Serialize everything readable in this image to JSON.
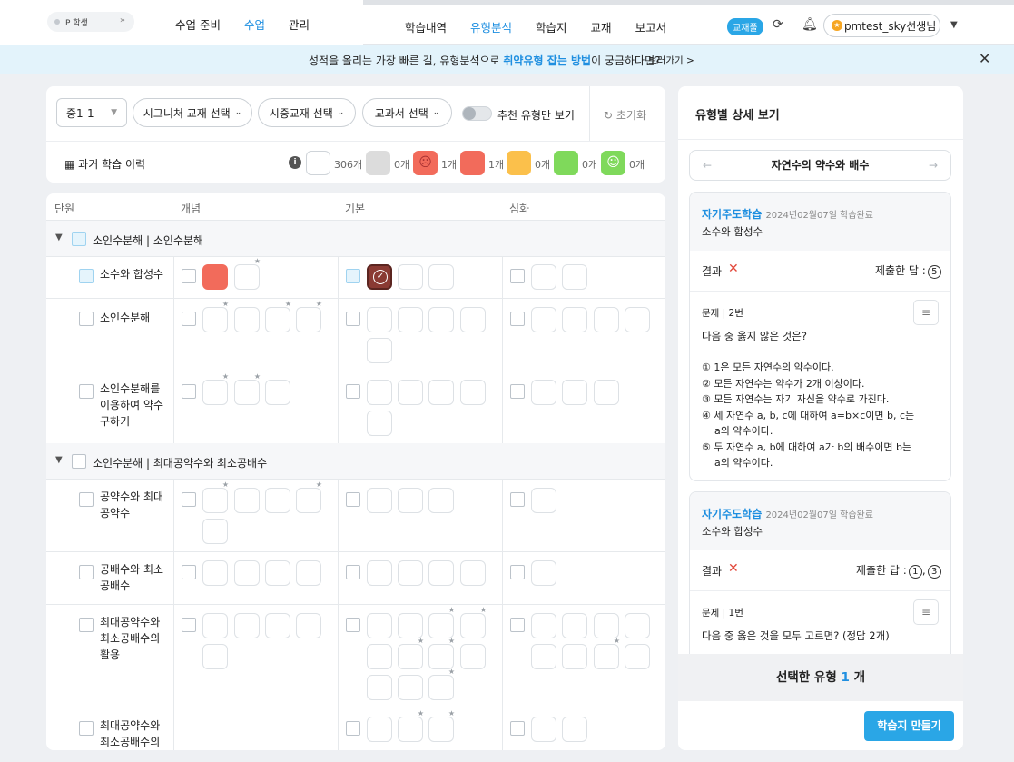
{
  "header": {
    "logo_text": "P 학생",
    "nav_left": [
      "수업 준비",
      "수업",
      "관리"
    ],
    "nav_left_active": 1,
    "nav_center": [
      "학습내역",
      "유형분석",
      "학습지",
      "교재",
      "보고서"
    ],
    "nav_center_active": 1,
    "book_badge": "교재풀",
    "user_name": "pmtest_sky선생님",
    "icons": [
      "refresh-icon",
      "bell-icon",
      "coin-icon",
      "caret-down-icon"
    ]
  },
  "banner": {
    "text_before": "성적을 올리는 가장 빠른 길, 유형분석으로 ",
    "text_highlight": "취약유형 잡는 방법",
    "text_after": "이 궁금하다면?",
    "link": "보러가기 >"
  },
  "filters": {
    "grade": "중1-1",
    "signature": "시그니처 교재 선택",
    "market": "시중교재 선택",
    "textbook": "교과서 선택",
    "toggle_label": "추천 유형만 보기",
    "toggle_on": false,
    "reset": "초기화",
    "history": "과거 학습 이력",
    "legend": [
      {
        "count": "306개",
        "color": "#ffffff"
      },
      {
        "count": "0개",
        "color": "#dcdcdc"
      },
      {
        "count": "1개",
        "color": "#f26b5b"
      },
      {
        "count": "1개",
        "color": "#f26b5b"
      },
      {
        "count": "0개",
        "color": "#fbc04b"
      },
      {
        "count": "0개",
        "color": "#7fd95b"
      },
      {
        "count": "0개",
        "color": "#7fd95b"
      }
    ]
  },
  "table": {
    "headers": [
      "단원",
      "개념",
      "기본",
      "심화"
    ],
    "group1": "소인수분해 | 소인수분해",
    "group2": "소인수분해 | 최대공약수와 최소공배수",
    "units": [
      "소수와 합성수",
      "소인수분해",
      "소인수분해를 이용하여 약수 구하기",
      "공약수와 최대공약수",
      "공배수와 최소공배수",
      "최대공약수와 최소공배수의 활용",
      "최대공약수와 최소공배수의"
    ]
  },
  "panel": {
    "title": "유형별 상세 보기",
    "topic": "자연수의 약수와 배수",
    "cards": [
      {
        "source": "자기주도학습",
        "date": "2024년02월07일 학습완료",
        "topic": "소수와 합성수",
        "result_label": "결과",
        "submitted_label": "제출한 답 :",
        "submitted": [
          "5"
        ],
        "q_no": "문제 | 2번",
        "question": "다음 중 옳지 않은 것은?",
        "choices": [
          "① 1은 모든 자연수의 약수이다.",
          "② 모든 자연수는 약수가 2개 이상이다.",
          "③ 모든 자연수는 자기 자신을 약수로 가진다.",
          "④ 세 자연수 a, b, c에 대하여 a=b×c이면 b, c는",
          "    a의 약수이다.",
          "⑤ 두 자연수 a, b에 대하여 a가 b의 배수이면 b는",
          "    a의 약수이다."
        ]
      },
      {
        "source": "자기주도학습",
        "date": "2024년02월07일 학습완료",
        "topic": "소수와 합성수",
        "result_label": "결과",
        "submitted_label": "제출한 답 :",
        "submitted": [
          "1",
          "3"
        ],
        "q_no": "문제 | 1번",
        "question": "다음 중 옳은 것을 모두 고르면? (정답 2개)"
      }
    ],
    "selected_prefix": "선택한 유형",
    "selected_count": "1",
    "selected_suffix": "개",
    "make_button": "학습지 만들기"
  }
}
